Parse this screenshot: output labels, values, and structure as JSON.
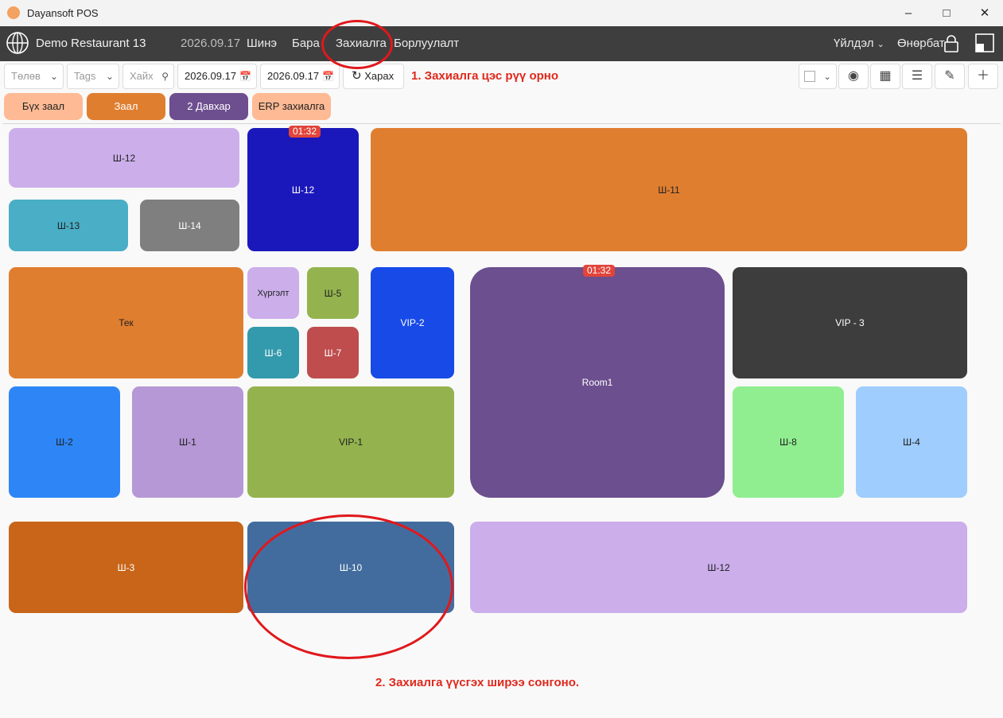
{
  "window": {
    "title": "Dayansoft POS"
  },
  "nav": {
    "brand": "Demo Restaurant 13",
    "date": "2026.09.17",
    "links": [
      "Шинэ",
      "Бара",
      "Захиалга",
      "Борлуулалт"
    ],
    "operations": "Үйлдэл",
    "user": "Өнөрбат"
  },
  "filters": {
    "status_placeholder": "Төлөв",
    "tags_placeholder": "Tags",
    "search_placeholder": "Хайх",
    "date_from": "2026.09.17",
    "date_to": "2026.09.17",
    "view_button": "Харах"
  },
  "annotations": {
    "step1": "1. Захиалга цэс рүү орно",
    "step2": "2. Захиалга үүсгэх ширээ сонгоно."
  },
  "halls": [
    {
      "label": "Бүх заал",
      "color": "#fdba94"
    },
    {
      "label": "Заал",
      "color": "#e07e30"
    },
    {
      "label": "2 Давхар",
      "color": "#6d4e8e"
    },
    {
      "label": "ERP захиалга",
      "color": "#fdba94"
    }
  ],
  "tables": [
    {
      "label": "Ш-12",
      "color": "#cbaeea"
    },
    {
      "label": "Ш-12",
      "color": "#1b18bb",
      "badge": "01:32"
    },
    {
      "label": "Ш-11",
      "color": "#e07e30"
    },
    {
      "label": "Ш-13",
      "color": "#4aaec6"
    },
    {
      "label": "Ш-14",
      "color": "#7f7f7f"
    },
    {
      "label": "Тек",
      "color": "#e07e30"
    },
    {
      "label": "Хүргэлт",
      "color": "#cbaeea"
    },
    {
      "label": "Ш-5",
      "color": "#94b34e"
    },
    {
      "label": "VIP-2",
      "color": "#184ae8"
    },
    {
      "label": "Room1",
      "color": "#6c4f8e",
      "badge": "01:32"
    },
    {
      "label": "VIP - 3",
      "color": "#3d3d3d"
    },
    {
      "label": "Ш-6",
      "color": "#3399ad"
    },
    {
      "label": "Ш-7",
      "color": "#bf4d4d"
    },
    {
      "label": "Ш-2",
      "color": "#2e86f6"
    },
    {
      "label": "Ш-1",
      "color": "#b598d5"
    },
    {
      "label": "VIP-1",
      "color": "#94b34e"
    },
    {
      "label": "Ш-8",
      "color": "#90ee90"
    },
    {
      "label": "Ш-4",
      "color": "#9fcdfd"
    },
    {
      "label": "Ш-3",
      "color": "#c86518"
    },
    {
      "label": "Ш-10",
      "color": "#436c9e"
    },
    {
      "label": "Ш-12",
      "color": "#cbaeea"
    }
  ]
}
